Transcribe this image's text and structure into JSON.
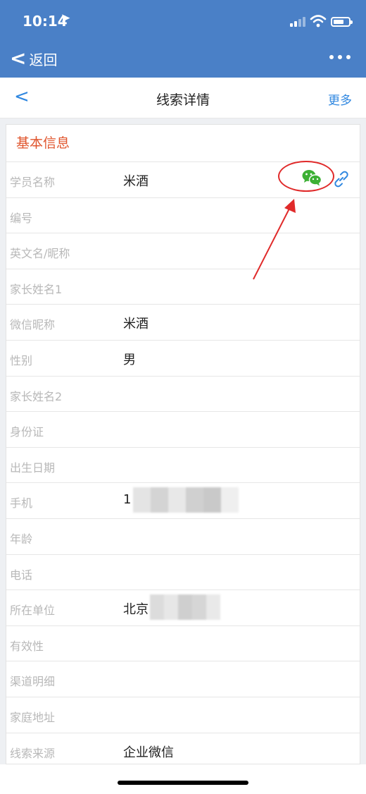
{
  "status_bar": {
    "time": "10:14",
    "location_glyph": "➤"
  },
  "app_bar": {
    "back_label": "返回",
    "menu_icon": "more-dots-icon"
  },
  "nav": {
    "back_glyph": "<",
    "title": "线索详情",
    "more_label": "更多"
  },
  "section": {
    "title": "基本信息"
  },
  "fields": [
    {
      "label": "学员名称",
      "value": "米酒"
    },
    {
      "label": "编号",
      "value": ""
    },
    {
      "label": "英文名/昵称",
      "value": ""
    },
    {
      "label": "家长姓名1",
      "value": ""
    },
    {
      "label": "微信昵称",
      "value": "米酒"
    },
    {
      "label": "性别",
      "value": "男"
    },
    {
      "label": "家长姓名2",
      "value": ""
    },
    {
      "label": "身份证",
      "value": ""
    },
    {
      "label": "出生日期",
      "value": ""
    },
    {
      "label": "手机",
      "value": "1"
    },
    {
      "label": "年龄",
      "value": ""
    },
    {
      "label": "电话",
      "value": ""
    },
    {
      "label": "所在单位",
      "value": "北京"
    },
    {
      "label": "有效性",
      "value": ""
    },
    {
      "label": "渠道明细",
      "value": ""
    },
    {
      "label": "家庭地址",
      "value": ""
    },
    {
      "label": "线索来源",
      "value": "企业微信"
    }
  ],
  "colors": {
    "header_blue": "#4a80c7",
    "accent_blue": "#2f87e0",
    "section_red": "#e0552d",
    "wechat_green": "#3cb034",
    "annotation_red": "#e02a2a"
  }
}
